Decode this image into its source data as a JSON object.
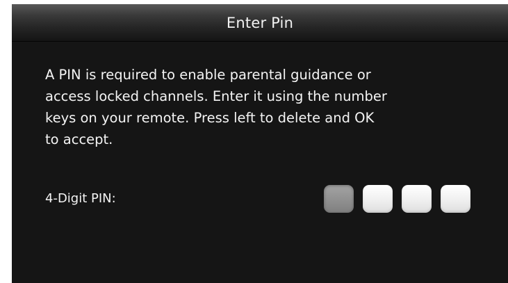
{
  "dialog": {
    "title": "Enter Pin",
    "message": "A PIN is required to enable parental guidance or\naccess locked channels.  Enter it using the number\nkeys on your remote.  Press left to delete and OK\nto accept.",
    "pin_label": "4-Digit PIN:",
    "pin_digits_entered": 0,
    "pin_length": 4,
    "active_digit_index": 0
  },
  "colors": {
    "background": "#151515",
    "text": "#f4f4f4",
    "pin_box": "#f1f1f1",
    "pin_box_active": "#909090"
  }
}
